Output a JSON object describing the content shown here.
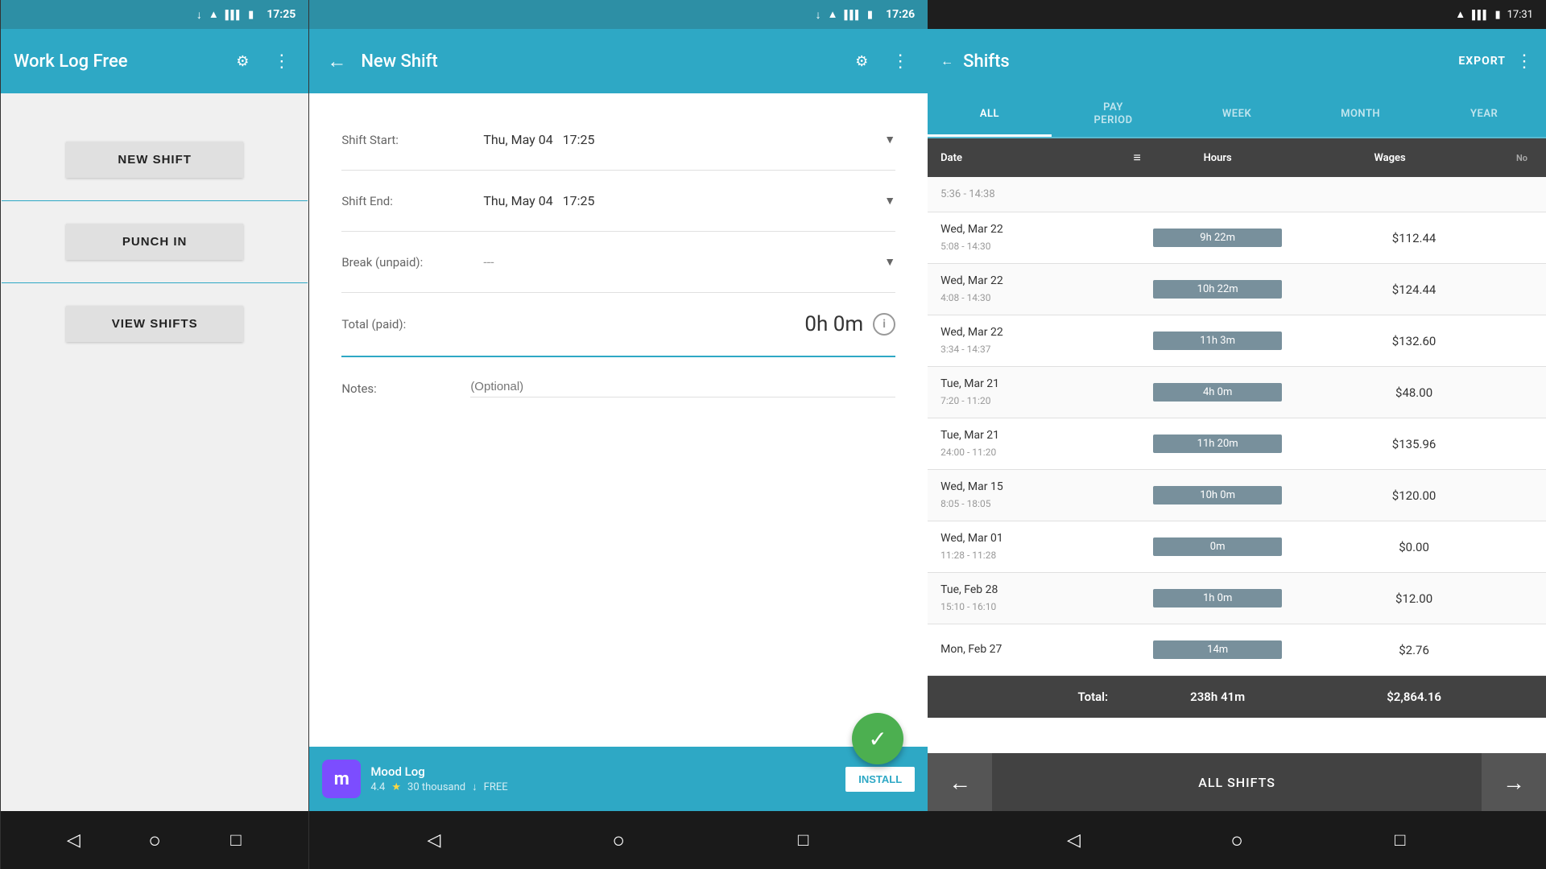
{
  "panel1": {
    "statusBar": {
      "time": "17:25"
    },
    "appBar": {
      "title": "Work Log Free"
    },
    "buttons": {
      "newShift": "NEW SHIFT",
      "punchIn": "PUNCH IN",
      "viewShifts": "VIEW SHIFTS"
    },
    "nav": {
      "back": "◁",
      "home": "○",
      "square": "□"
    }
  },
  "panel2": {
    "statusBar": {
      "time": "17:26"
    },
    "appBar": {
      "title": "New Shift"
    },
    "form": {
      "shiftStartLabel": "Shift Start:",
      "shiftStartDate": "Thu, May 04",
      "shiftStartTime": "17:25",
      "shiftEndLabel": "Shift End:",
      "shiftEndDate": "Thu, May 04",
      "shiftEndTime": "17:25",
      "breakLabel": "Break (unpaid):",
      "breakValue": "---",
      "totalLabel": "Total (paid):",
      "totalValue": "0h 0m",
      "notesLabel": "Notes:",
      "notesPlaceholder": "(Optional)"
    },
    "ad": {
      "icon": "m",
      "title": "Mood Log",
      "rating": "4.4",
      "downloads": "30 thousand",
      "price": "FREE",
      "installLabel": "INSTALL"
    },
    "nav": {
      "back": "◁",
      "home": "○",
      "square": "□"
    }
  },
  "panel3": {
    "statusBar": {
      "time": "17:31"
    },
    "appBar": {
      "title": "Shifts",
      "export": "EXPORT"
    },
    "tabs": [
      {
        "label": "ALL",
        "active": true
      },
      {
        "label": "PAY PERIOD",
        "active": false
      },
      {
        "label": "WEEK",
        "active": false
      },
      {
        "label": "MONTH",
        "active": false
      },
      {
        "label": "YEAR",
        "active": false
      }
    ],
    "tableHeader": {
      "date": "Date",
      "hours": "Hours",
      "wages": "Wages",
      "note": "No"
    },
    "rows": [
      {
        "date": "5:36 - 14:38",
        "hours": "",
        "wages": "",
        "truncated": true
      },
      {
        "date": "Wed, Mar 22\n5:08 - 14:30",
        "hours": "9h 22m",
        "wages": "$112.44"
      },
      {
        "date": "Wed, Mar 22\n4:08 - 14:30",
        "hours": "10h 22m",
        "wages": "$124.44"
      },
      {
        "date": "Wed, Mar 22\n3:34 - 14:37",
        "hours": "11h 3m",
        "wages": "$132.60"
      },
      {
        "date": "Tue, Mar 21\n7:20 - 11:20",
        "hours": "4h 0m",
        "wages": "$48.00"
      },
      {
        "date": "Tue, Mar 21\n24:00 - 11:20",
        "hours": "11h 20m",
        "wages": "$135.96"
      },
      {
        "date": "Wed, Mar 15\n8:05 - 18:05",
        "hours": "10h 0m",
        "wages": "$120.00"
      },
      {
        "date": "Wed, Mar 01\n11:28 - 11:28",
        "hours": "0m",
        "wages": "$0.00"
      },
      {
        "date": "Tue, Feb 28\n15:10 - 16:10",
        "hours": "1h 0m",
        "wages": "$12.00"
      },
      {
        "date": "Mon, Feb 27",
        "hours": "14m",
        "wages": "$2.76",
        "truncated": false
      }
    ],
    "total": {
      "label": "Total:",
      "hours": "238h 41m",
      "wages": "$2,864.16"
    },
    "bottomBar": {
      "allShifts": "ALL SHIFTS",
      "prev": "←",
      "next": "→"
    },
    "nav": {
      "back": "◁",
      "home": "○",
      "square": "□"
    }
  }
}
